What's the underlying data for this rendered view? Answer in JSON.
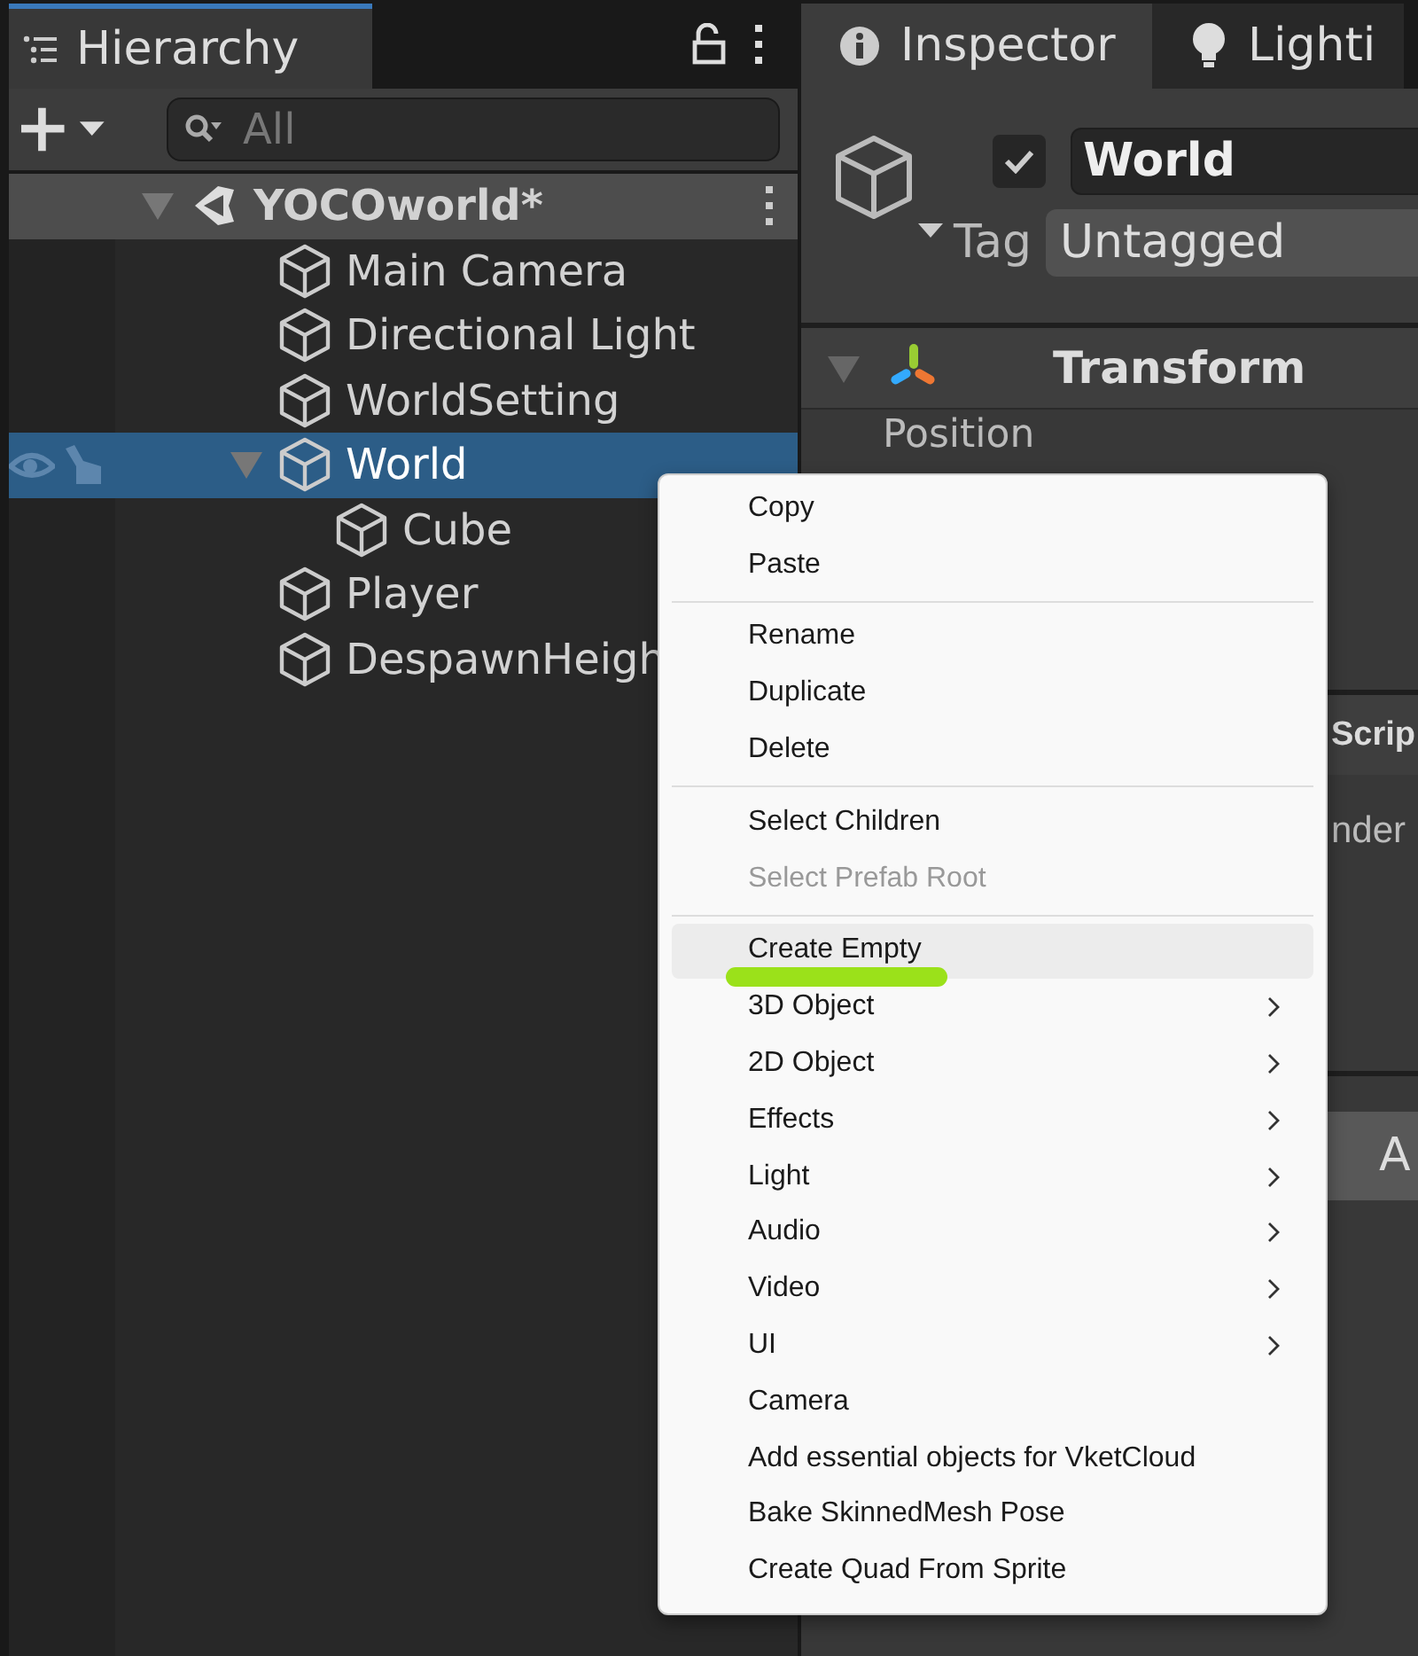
{
  "hierarchy": {
    "title": "Hierarchy",
    "search": {
      "placeholder": "All"
    },
    "tree": [
      {
        "label": "YOCOworld*",
        "kind": "scene",
        "expanded": true,
        "selected": false,
        "children": [
          {
            "label": "Main Camera",
            "kind": "object",
            "selected": false
          },
          {
            "label": "Directional Light",
            "kind": "object",
            "selected": false
          },
          {
            "label": "WorldSetting",
            "kind": "object",
            "selected": false
          },
          {
            "label": "World",
            "kind": "object",
            "selected": true,
            "expanded": true,
            "children": [
              {
                "label": "Cube",
                "kind": "object",
                "selected": false
              }
            ]
          },
          {
            "label": "Player",
            "kind": "object",
            "selected": false
          },
          {
            "label": "DespawnHeigh",
            "kind": "object",
            "selected": false
          }
        ]
      }
    ]
  },
  "inspector": {
    "tabs": [
      {
        "label": "Inspector",
        "kind": "info",
        "selected": true
      },
      {
        "label": "Lighti",
        "kind": "bulb",
        "selected": false
      }
    ],
    "active": true,
    "name": "World",
    "tag_label": "Tag",
    "tag": "Untagged",
    "transform": {
      "title": "Transform",
      "expanded": true,
      "field": "Position"
    },
    "section_2": "Scrip",
    "section_2_text": "nder",
    "section_3": "A"
  },
  "context_menu": {
    "groups": [
      [
        {
          "label": "Copy",
          "disabled": false,
          "submenu": false,
          "selected": false
        },
        {
          "label": "Paste",
          "disabled": false,
          "submenu": false,
          "selected": false
        }
      ],
      [
        {
          "label": "Rename",
          "disabled": false,
          "submenu": false,
          "selected": false
        },
        {
          "label": "Duplicate",
          "disabled": false,
          "submenu": false,
          "selected": false
        },
        {
          "label": "Delete",
          "disabled": false,
          "submenu": false,
          "selected": false
        }
      ],
      [
        {
          "label": "Select Children",
          "disabled": false,
          "submenu": false,
          "selected": false
        },
        {
          "label": "Select Prefab Root",
          "disabled": true,
          "submenu": false,
          "selected": false
        }
      ],
      [
        {
          "label": "Create Empty",
          "disabled": false,
          "submenu": false,
          "selected": true,
          "marked": true
        },
        {
          "label": "3D Object",
          "disabled": false,
          "submenu": true,
          "selected": false
        },
        {
          "label": "2D Object",
          "disabled": false,
          "submenu": true,
          "selected": false
        },
        {
          "label": "Effects",
          "disabled": false,
          "submenu": true,
          "selected": false
        },
        {
          "label": "Light",
          "disabled": false,
          "submenu": true,
          "selected": false
        },
        {
          "label": "Audio",
          "disabled": false,
          "submenu": true,
          "selected": false
        },
        {
          "label": "Video",
          "disabled": false,
          "submenu": true,
          "selected": false
        },
        {
          "label": "UI",
          "disabled": false,
          "submenu": true,
          "selected": false
        },
        {
          "label": "Camera",
          "disabled": false,
          "submenu": false,
          "selected": false
        },
        {
          "label": "Add essential objects for VketCloud",
          "disabled": false,
          "submenu": false,
          "selected": false
        },
        {
          "label": "Bake SkinnedMesh Pose",
          "disabled": false,
          "submenu": false,
          "selected": false
        },
        {
          "label": "Create Quad From Sprite",
          "disabled": false,
          "submenu": false,
          "selected": false
        }
      ]
    ]
  }
}
